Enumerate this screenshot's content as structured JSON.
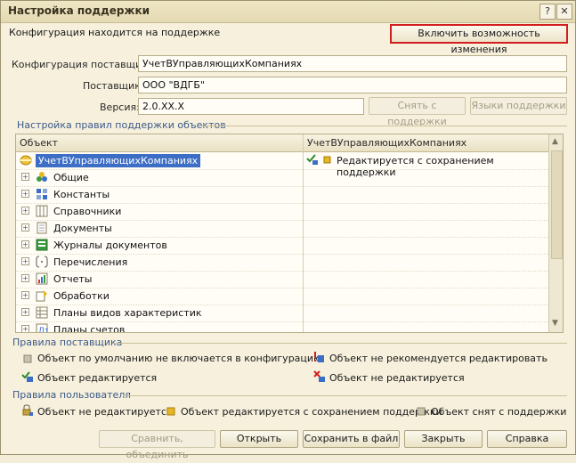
{
  "window": {
    "title": "Настройка поддержки",
    "help_glyph": "?",
    "close_glyph": "✕"
  },
  "status": {
    "text": "Конфигурация находится на поддержке",
    "enable_button": "Включить возможность изменения"
  },
  "vendor": {
    "config_label": "Конфигурация поставщика:",
    "config_value": "УчетВУправляющихКомпаниях",
    "supplier_label": "Поставщик:",
    "supplier_value": "ООО \"ВДГБ\"",
    "version_label": "Версия:",
    "version_value": "2.0.XX.X",
    "remove_support_button": "Снять с поддержки",
    "languages_button": "Языки поддержки"
  },
  "rules_group": {
    "title": "Настройка правил поддержки объектов",
    "col_object": "Объект",
    "col_config": "УчетВУправляющихКомпаниях",
    "root": {
      "label": "УчетВУправляющихКомпаниях",
      "status": "Редактируется с сохранением поддержки"
    },
    "items": [
      {
        "label": "Общие",
        "icon": "common-icon"
      },
      {
        "label": "Константы",
        "icon": "constants-icon"
      },
      {
        "label": "Справочники",
        "icon": "catalogs-icon"
      },
      {
        "label": "Документы",
        "icon": "documents-icon"
      },
      {
        "label": "Журналы документов",
        "icon": "journals-icon"
      },
      {
        "label": "Перечисления",
        "icon": "enums-icon"
      },
      {
        "label": "Отчеты",
        "icon": "reports-icon"
      },
      {
        "label": "Обработки",
        "icon": "processing-icon"
      },
      {
        "label": "Планы видов характеристик",
        "icon": "chart-types-icon"
      },
      {
        "label": "Планы счетов",
        "icon": "accounts-icon"
      }
    ]
  },
  "vendor_rules": {
    "title": "Правила поставщика",
    "r1": "Объект по умолчанию не включается в конфигурацию",
    "r2": "Объект не рекомендуется редактировать",
    "r3": "Объект редактируется",
    "r4": "Объект не редактируется"
  },
  "user_rules": {
    "title": "Правила пользователя",
    "u1": "Объект не редактируется",
    "u2": "Объект редактируется с сохранением поддержки",
    "u3": "Объект снят с поддержки"
  },
  "buttons": {
    "compare": "Сравнить, объединить",
    "open": "Открыть",
    "save": "Сохранить в файл",
    "close": "Закрыть",
    "help": "Справка"
  },
  "colors": {
    "selection": "#3d6ec5",
    "highlight_border": "#d21e1e",
    "group_title": "#3b5a8a"
  }
}
